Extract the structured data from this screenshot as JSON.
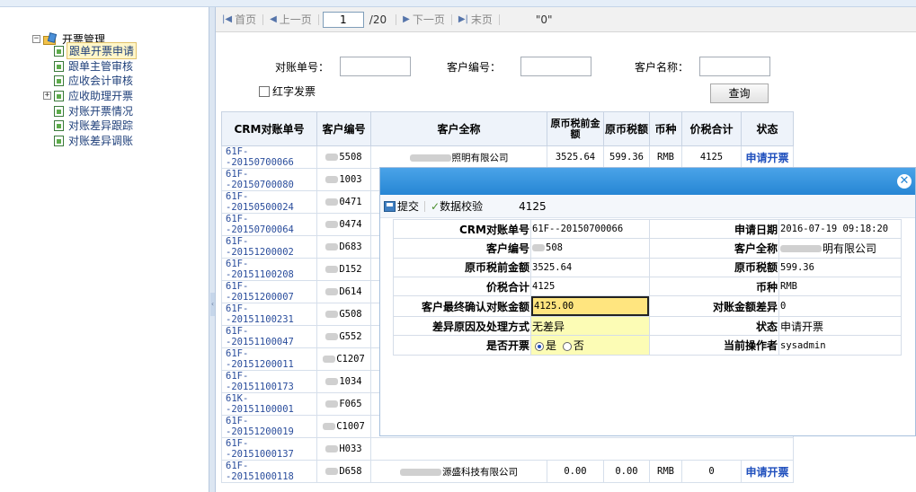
{
  "tree": {
    "root": "开票管理",
    "items": [
      "跟单开票申请",
      "跟单主管审核",
      "应收会计审核",
      "应收助理开票",
      "对账开票情况",
      "对账差异跟踪",
      "对账差异调账"
    ],
    "selected_index": 0
  },
  "pager": {
    "first": "首页",
    "prev": "上一页",
    "page": "1",
    "total": "/20",
    "next": "下一页",
    "last": "末页",
    "info": "\"0\""
  },
  "search": {
    "acct_label": "对账单号：",
    "cust_no_label": "客户编号：",
    "cust_name_label": "客户名称：",
    "red_label": "红字发票",
    "query_button": "查询"
  },
  "grid": {
    "headers": [
      "CRM对账单号",
      "客户编号",
      "客户全称",
      "原币税前金额",
      "原币税额",
      "币种",
      "价税合计",
      "状态"
    ],
    "rows": [
      {
        "acct": "61F--20150700066",
        "cust": "5508",
        "name": "照明有限公司",
        "pre": "3525.64",
        "tax": "599.36",
        "cur": "RMB",
        "total": "4125",
        "status": "申请开票"
      },
      {
        "acct": "61F--20150700080",
        "cust": "1003"
      },
      {
        "acct": "61F--20150500024",
        "cust": "0471"
      },
      {
        "acct": "61F--20150700064",
        "cust": "0474"
      },
      {
        "acct": "61F--20151200002",
        "cust": "D683"
      },
      {
        "acct": "61F--20151100208",
        "cust": "D152"
      },
      {
        "acct": "61F--20151200007",
        "cust": "D614"
      },
      {
        "acct": "61F--20151100231",
        "cust": "G508"
      },
      {
        "acct": "61F--20151100047",
        "cust": "G552"
      },
      {
        "acct": "61F--20151200011",
        "cust": "C1207"
      },
      {
        "acct": "61F--20151100173",
        "cust": "1034"
      },
      {
        "acct": "61K--20151100001",
        "cust": "F065"
      },
      {
        "acct": "61F--20151200019",
        "cust": "C1007"
      },
      {
        "acct": "61F--20151000137",
        "cust": "H033"
      },
      {
        "acct": "61F--20151000118",
        "cust": "D658",
        "name": "源盛科技有限公司",
        "pre": "0.00",
        "tax": "0.00",
        "cur": "RMB",
        "total": "0",
        "status": "申请开票"
      }
    ]
  },
  "dialog": {
    "submit": "提交",
    "verify": "数据校验",
    "toolbar_value": "4125",
    "fields": {
      "crm_no_label": "CRM对账单号",
      "crm_no": "61F--20150700066",
      "apply_date_label": "申请日期",
      "apply_date": "2016-07-19 09:18:20",
      "cust_no_label": "客户编号",
      "cust_no": "508",
      "cust_name_label": "客户全称",
      "cust_name": "明有限公司",
      "pre_label": "原币税前金额",
      "pre": "3525.64",
      "tax_label": "原币税额",
      "tax": "599.36",
      "total_label": "价税合计",
      "total": "4125",
      "currency_label": "币种",
      "currency": "RMB",
      "final_label": "客户最终确认对账金额",
      "final": "4125.00",
      "diff_label": "对账金额差异",
      "diff": "0",
      "reason_label": "差异原因及处理方式",
      "reason": "无差异",
      "status_label": "状态",
      "status": "申请开票",
      "invoice_label": "是否开票",
      "yes": "是",
      "no": "否",
      "operator_label": "当前操作者",
      "operator": "sysadmin"
    }
  }
}
